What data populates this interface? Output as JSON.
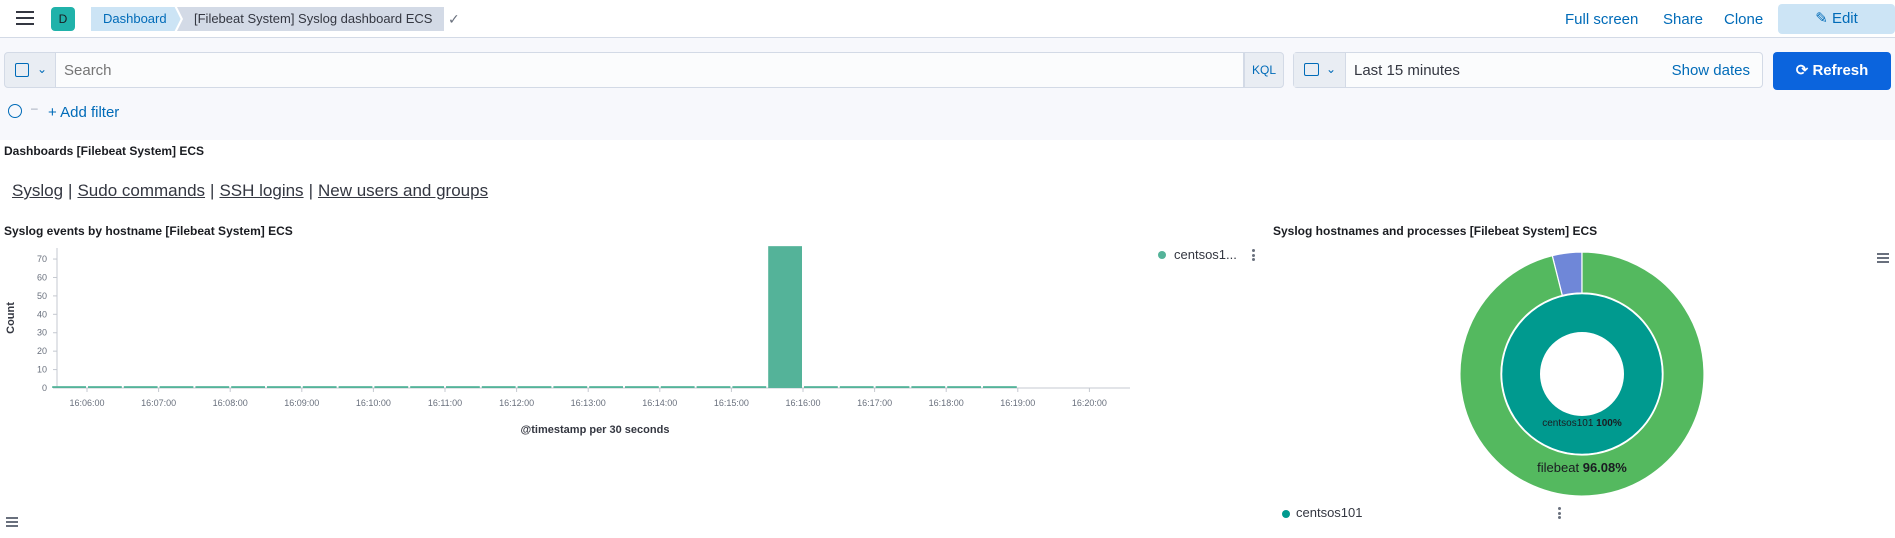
{
  "header": {
    "avatar_letter": "D",
    "breadcrumb_root": "Dashboard",
    "breadcrumb_current": "[Filebeat System] Syslog dashboard ECS",
    "full_screen": "Full screen",
    "share": "Share",
    "clone": "Clone",
    "edit": "Edit"
  },
  "query": {
    "search_placeholder": "Search",
    "language": "KQL",
    "time_range": "Last 15 minutes",
    "show_dates": "Show dates",
    "refresh": "Refresh",
    "add_filter": "+ Add filter"
  },
  "markdown_panel": {
    "title": "Dashboards [Filebeat System] ECS",
    "links": [
      "Syslog",
      "Sudo commands",
      "SSH logins",
      "New users and groups"
    ]
  },
  "bar_panel": {
    "title": "Syslog events by hostname [Filebeat System] ECS",
    "legend_label": "centsos1...",
    "legend_color": "#54b399"
  },
  "pie_panel": {
    "title": "Syslog hostnames and processes [Filebeat System] ECS",
    "inner_label_name": "centsos101",
    "inner_label_pct": "100%",
    "outer_label_name": "filebeat",
    "outer_label_pct": "96.08%",
    "legend_label": "centsos101",
    "legend_color": "#009a8f"
  },
  "chart_data": [
    {
      "type": "bar",
      "xlabel": "@timestamp per 30 seconds",
      "ylabel": "Count",
      "ylim": [
        0,
        76
      ],
      "yticks": [
        0,
        10,
        20,
        30,
        40,
        50,
        60,
        70
      ],
      "xticks": [
        "16:06:00",
        "16:07:00",
        "16:08:00",
        "16:09:00",
        "16:10:00",
        "16:11:00",
        "16:12:00",
        "16:13:00",
        "16:14:00",
        "16:15:00",
        "16:16:00",
        "16:17:00",
        "16:18:00",
        "16:19:00",
        "16:20:00"
      ],
      "series": [
        {
          "color": "#54b399",
          "values": [
            1,
            1,
            1,
            1,
            1,
            1,
            1,
            1,
            1,
            1,
            1,
            1,
            1,
            1,
            1,
            1,
            1,
            1,
            1,
            1,
            77,
            1,
            1,
            1,
            1,
            1,
            1
          ]
        }
      ],
      "grid": false
    },
    {
      "type": "pie",
      "rings": [
        {
          "ring": "inner",
          "slices": [
            {
              "label": "centsos101",
              "value": 100,
              "color": "#009a8f"
            }
          ]
        },
        {
          "ring": "outer",
          "slices": [
            {
              "label": "filebeat",
              "value": 96.08,
              "color": "#54b95f"
            },
            {
              "label": "",
              "value": 3.92,
              "color": "#6f87d8"
            }
          ]
        }
      ]
    }
  ]
}
